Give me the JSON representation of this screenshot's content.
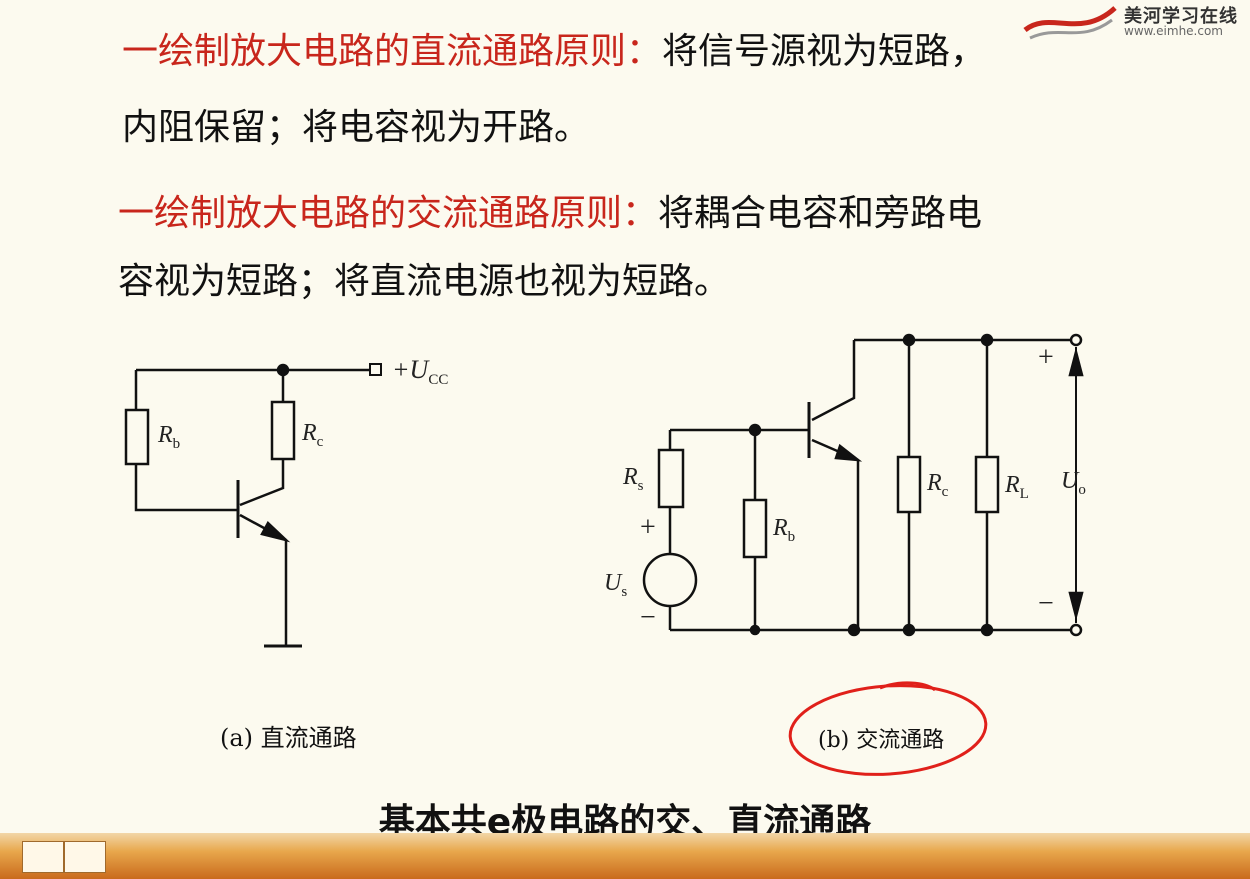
{
  "slide": {
    "p1_heading": "一绘制放大电路的直流通路原则：",
    "p1_body_a": "将信号源视为短路，",
    "p1_body_b": "内阻保留；将电容视为开路。",
    "p2_heading": "一绘制放大电路的交流通路原则：",
    "p2_body_a": "将耦合电容和旁路电",
    "p2_body_b": "容视为短路；将直流电源也视为短路。",
    "caption_a": "(a) 直流通路",
    "caption_b": "(b) 交流通路",
    "main_caption": "基本共e极电路的交、直流通路"
  },
  "logo": {
    "name": "美河学习在线",
    "url": "www.eimhe.com"
  },
  "labels": {
    "rb": "R",
    "rb_sub": "b",
    "rc": "R",
    "rc_sub": "c",
    "ucc": "+U",
    "ucc_sub": "CC",
    "rs": "R",
    "rs_sub": "s",
    "us": "U",
    "us_sub": "s",
    "rl": "R",
    "rl_sub": "L",
    "uo": "U",
    "uo_sub": "o",
    "plus": "+",
    "minus": "−"
  },
  "colors": {
    "accent_red": "#c8261c",
    "annotation_circle": "#e0201a",
    "taskbar": "#e8a74c"
  }
}
